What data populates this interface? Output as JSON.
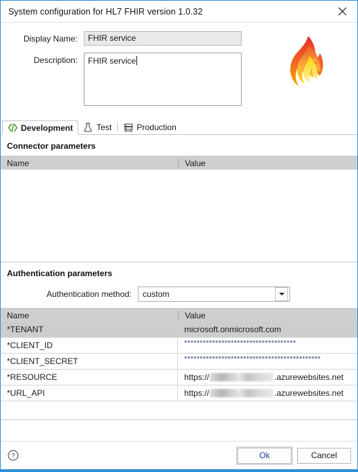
{
  "window": {
    "title": "System configuration for HL7 FHIR version 1.0.32",
    "close_icon": "close-icon",
    "accent_color": "#2f8fd8"
  },
  "header": {
    "display_name": {
      "label": "Display Name:",
      "value": "FHIR service"
    },
    "description": {
      "label": "Description:",
      "value": "FHIR service"
    },
    "logo": {
      "name": "fhir-flame-logo",
      "colors": [
        "#e8322a",
        "#f7941e",
        "#ffd400",
        "#fff6c4"
      ]
    }
  },
  "tabs": [
    {
      "label": "Development",
      "icon": "code-brackets-icon",
      "active": true
    },
    {
      "label": "Test",
      "icon": "flask-icon",
      "active": false
    },
    {
      "label": "Production",
      "icon": "server-rack-icon",
      "active": false
    }
  ],
  "connector": {
    "section_title": "Connector parameters",
    "columns": [
      "Name",
      "Value"
    ],
    "rows": []
  },
  "authentication": {
    "section_title": "Authentication parameters",
    "method_label": "Authentication method:",
    "method_value": "custom",
    "method_options": [
      "custom"
    ],
    "columns": [
      "Name",
      "Value"
    ],
    "rows": [
      {
        "name": "*TENANT",
        "value": "microsoft.onmicrosoft.com",
        "type": "text",
        "selected": true
      },
      {
        "name": "*CLIENT_ID",
        "value": "************************************",
        "type": "masked",
        "selected": false
      },
      {
        "name": "*CLIENT_SECRET",
        "value": "********************************************",
        "type": "masked",
        "selected": false
      },
      {
        "name": "*RESOURCE",
        "value_prefix": "https://",
        "value_suffix": ".azurewebsites.net",
        "type": "redacted-url",
        "selected": false
      },
      {
        "name": "*URL_API",
        "value_prefix": "https://",
        "value_suffix": ".azurewebsites.net",
        "type": "redacted-url",
        "selected": false
      }
    ]
  },
  "footer": {
    "help_icon": "help-circle-icon",
    "ok_label": "Ok",
    "cancel_label": "Cancel"
  }
}
